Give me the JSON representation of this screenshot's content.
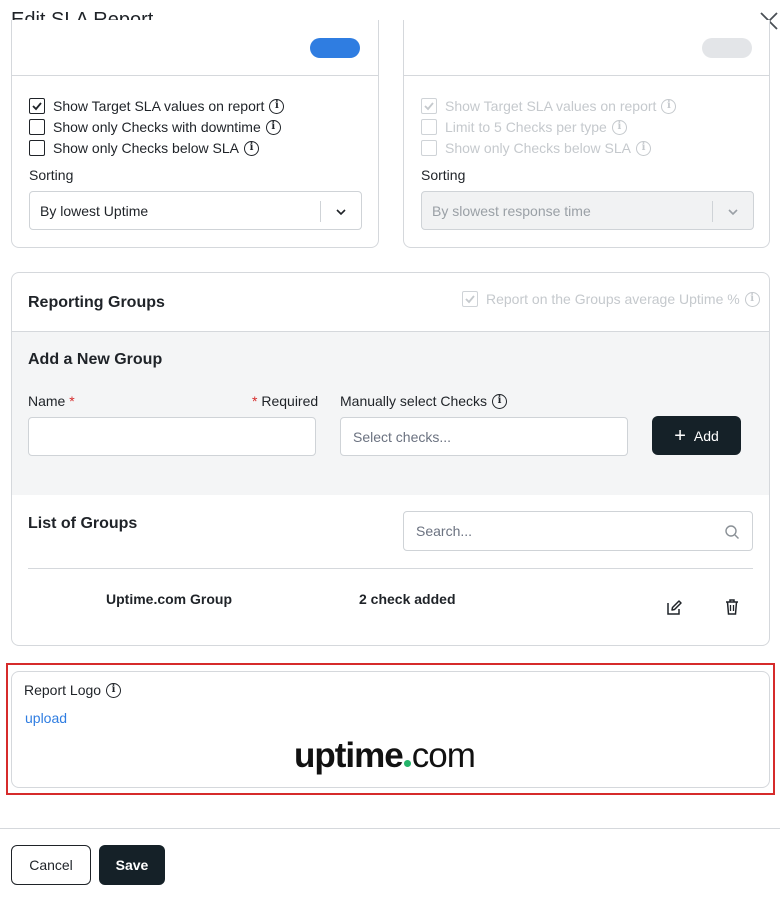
{
  "dialog": {
    "title": "Edit SLA Report"
  },
  "left_card": {
    "toggle_on": true,
    "options": [
      {
        "label": "Show Target SLA values on report",
        "checked": true
      },
      {
        "label": "Show only Checks with downtime",
        "checked": false
      },
      {
        "label": "Show only Checks below SLA",
        "checked": false
      }
    ],
    "sorting_label": "Sorting",
    "sorting_value": "By lowest Uptime"
  },
  "right_card": {
    "toggle_on": false,
    "options": [
      {
        "label": "Show Target SLA values on report",
        "checked": true,
        "disabled": true
      },
      {
        "label": "Limit to 5 Checks per type",
        "checked": false,
        "disabled": true
      },
      {
        "label": "Show only Checks below SLA",
        "checked": false,
        "disabled": true
      }
    ],
    "sorting_label": "Sorting",
    "sorting_value": "By slowest response time"
  },
  "reporting_groups": {
    "title": "Reporting Groups",
    "average_uptime_label": "Report on the Groups average Uptime %",
    "average_uptime_checked": true,
    "new_group": {
      "title": "Add a New Group",
      "name_label": "Name",
      "required_star": "*",
      "required_label": "Required",
      "manual_label": "Manually select Checks",
      "checks_placeholder": "Select checks...",
      "add_label": "Add"
    },
    "list": {
      "title": "List of Groups",
      "search_placeholder": "Search...",
      "rows": [
        {
          "name": "Uptime.com Group",
          "count": "2 check added"
        }
      ]
    }
  },
  "report_logo": {
    "label": "Report Logo",
    "upload_label": "upload",
    "logo_text_main": "uptime",
    "logo_text_suffix": "com"
  },
  "footer": {
    "cancel_label": "Cancel",
    "save_label": "Save"
  },
  "colors": {
    "accent": "#2f7de1",
    "primary_button": "#152128",
    "highlight": "#d62b2b",
    "logo_dot": "#25b46a"
  }
}
